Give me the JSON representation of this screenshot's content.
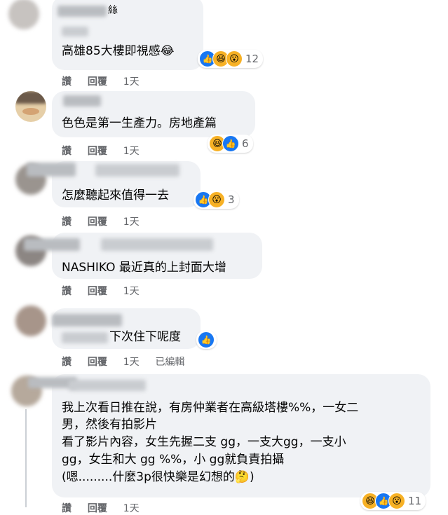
{
  "comments": [
    {
      "author_suffix": "絲",
      "text": "高雄85大樓即視感😂",
      "actions": {
        "like": "讚",
        "reply": "回覆",
        "time": "1天",
        "edited": ""
      },
      "reactions": {
        "icons": [
          "like",
          "haha",
          "wow"
        ],
        "count": "12"
      }
    },
    {
      "text": "色色是第一生產力。房地產篇",
      "actions": {
        "like": "讚",
        "reply": "回覆",
        "time": "1天",
        "edited": ""
      },
      "reactions": {
        "icons": [
          "haha",
          "like"
        ],
        "count": "6"
      }
    },
    {
      "text": "怎麼聽起來值得一去",
      "actions": {
        "like": "讚",
        "reply": "回覆",
        "time": "1天",
        "edited": ""
      },
      "reactions": {
        "icons": [
          "like",
          "wow"
        ],
        "count": "3"
      }
    },
    {
      "text": "NASHIKO 最近真的上封面大增",
      "actions": {
        "like": "讚",
        "reply": "回覆",
        "time": "1天",
        "edited": ""
      },
      "reactions": null
    },
    {
      "text": "下次住下呢度",
      "actions": {
        "like": "讚",
        "reply": "回覆",
        "time": "1天",
        "edited": "已編輯"
      },
      "reactions": {
        "icons": [
          "like"
        ],
        "count": ""
      }
    },
    {
      "lines": [
        "我上次看日推在說，有房仲業者在高級塔樓%%，一女二",
        "男，然後有拍影片",
        "看了影片內容，女生先握二支 gg，一支大gg，一支小",
        "gg，女生和大 gg %%，小 gg就負責拍攝",
        "(嗯.........什麼3p很快樂是幻想的🤔)"
      ],
      "actions": {
        "like": "讚",
        "reply": "回覆",
        "time": "1天",
        "edited": ""
      },
      "reactions": {
        "icons": [
          "haha",
          "like",
          "wow"
        ],
        "count": "11"
      }
    }
  ],
  "colors": {
    "bubble": "#f0f2f5",
    "meta": "#65676b",
    "like": "#1877f2",
    "emoji": "#f7b125"
  }
}
